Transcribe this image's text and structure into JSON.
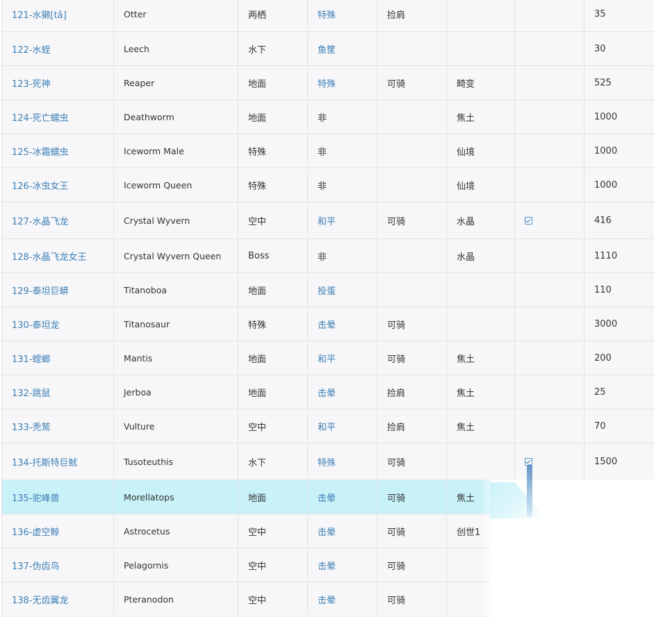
{
  "rows": [
    {
      "id": "121-水獭[tǎ]",
      "en": "Otter",
      "habitat": "两栖",
      "tame": "特殊",
      "tame_link": true,
      "ride": "捡肩",
      "item": "",
      "check": false,
      "value": "35"
    },
    {
      "id": "122-水蛭",
      "en": "Leech",
      "habitat": "水下",
      "tame": "鱼筐",
      "tame_link": true,
      "ride": "",
      "item": "",
      "check": false,
      "value": "30"
    },
    {
      "id": "123-死神",
      "en": "Reaper",
      "habitat": "地面",
      "tame": "特殊",
      "tame_link": true,
      "ride": "可骑",
      "item": "畸变",
      "check": false,
      "value": "525"
    },
    {
      "id": "124-死亡蠕虫",
      "en": "Deathworm",
      "habitat": "地面",
      "tame": "非",
      "tame_link": false,
      "ride": "",
      "item": "焦土",
      "check": false,
      "value": "1000"
    },
    {
      "id": "125-冰霜蠕虫",
      "en": "Iceworm Male",
      "habitat": "特殊",
      "tame": "非",
      "tame_link": false,
      "ride": "",
      "item": "仙境",
      "check": false,
      "value": "1000"
    },
    {
      "id": "126-冰虫女王",
      "en": "Iceworm Queen",
      "habitat": "特殊",
      "tame": "非",
      "tame_link": false,
      "ride": "",
      "item": "仙境",
      "check": false,
      "value": "1000"
    },
    {
      "id": "127-水晶飞龙",
      "en": "Crystal Wyvern",
      "habitat": "空中",
      "tame": "和平",
      "tame_link": true,
      "ride": "可骑",
      "item": "水晶",
      "check": true,
      "value": "416"
    },
    {
      "id": "128-水晶飞龙女王",
      "en": "Crystal Wyvern Queen",
      "habitat": "Boss",
      "tame": "非",
      "tame_link": false,
      "ride": "",
      "item": "水晶",
      "check": false,
      "value": "1110"
    },
    {
      "id": "129-泰坦巨蟒",
      "en": "Titanoboa",
      "habitat": "地面",
      "tame": "投蛋",
      "tame_link": true,
      "ride": "",
      "item": "",
      "check": false,
      "value": "110"
    },
    {
      "id": "130-泰坦龙",
      "en": "Titanosaur",
      "habitat": "特殊",
      "tame": "击晕",
      "tame_link": true,
      "ride": "可骑",
      "item": "",
      "check": false,
      "value": "3000"
    },
    {
      "id": "131-螳螂",
      "en": "Mantis",
      "habitat": "地面",
      "tame": "和平",
      "tame_link": true,
      "ride": "可骑",
      "item": "焦土",
      "check": false,
      "value": "200"
    },
    {
      "id": "132-跳鼠",
      "en": "Jerboa",
      "habitat": "地面",
      "tame": "击晕",
      "tame_link": true,
      "ride": "捡肩",
      "item": "焦土",
      "check": false,
      "value": "25"
    },
    {
      "id": "133-秃鹫",
      "en": "Vulture",
      "habitat": "空中",
      "tame": "和平",
      "tame_link": true,
      "ride": "捡肩",
      "item": "焦土",
      "check": false,
      "value": "70"
    },
    {
      "id": "134-托斯特巨鱿",
      "en": "Tusoteuthis",
      "habitat": "水下",
      "tame": "特殊",
      "tame_link": true,
      "ride": "可骑",
      "item": "",
      "check": true,
      "value": "1500"
    },
    {
      "id": "135-驼峰兽",
      "en": "Morellatops",
      "habitat": "地面",
      "tame": "击晕",
      "tame_link": true,
      "ride": "可骑",
      "item": "焦土",
      "check": false,
      "value": "",
      "highlight": true
    },
    {
      "id": "136-虚空鲸",
      "en": "Astrocetus",
      "habitat": "空中",
      "tame": "击晕",
      "tame_link": true,
      "ride": "可骑",
      "item": "创世1",
      "check": false,
      "value": ""
    },
    {
      "id": "137-伪齿鸟",
      "en": "Pelagornis",
      "habitat": "空中",
      "tame": "击晕",
      "tame_link": true,
      "ride": "可骑",
      "item": "",
      "check": false,
      "value": ""
    },
    {
      "id": "138-无齿翼龙",
      "en": "Pteranodon",
      "habitat": "空中",
      "tame": "击晕",
      "tame_link": true,
      "ride": "可骑",
      "item": "",
      "check": false,
      "value": ""
    }
  ],
  "colors": {
    "link": "#3d7fb5",
    "text": "#333333",
    "row_bg": "#f7f7f9",
    "highlight_bg": "#c8f1f8",
    "border": "#e2e2e6"
  },
  "icons": {
    "check": "checkbox-checked-icon"
  }
}
